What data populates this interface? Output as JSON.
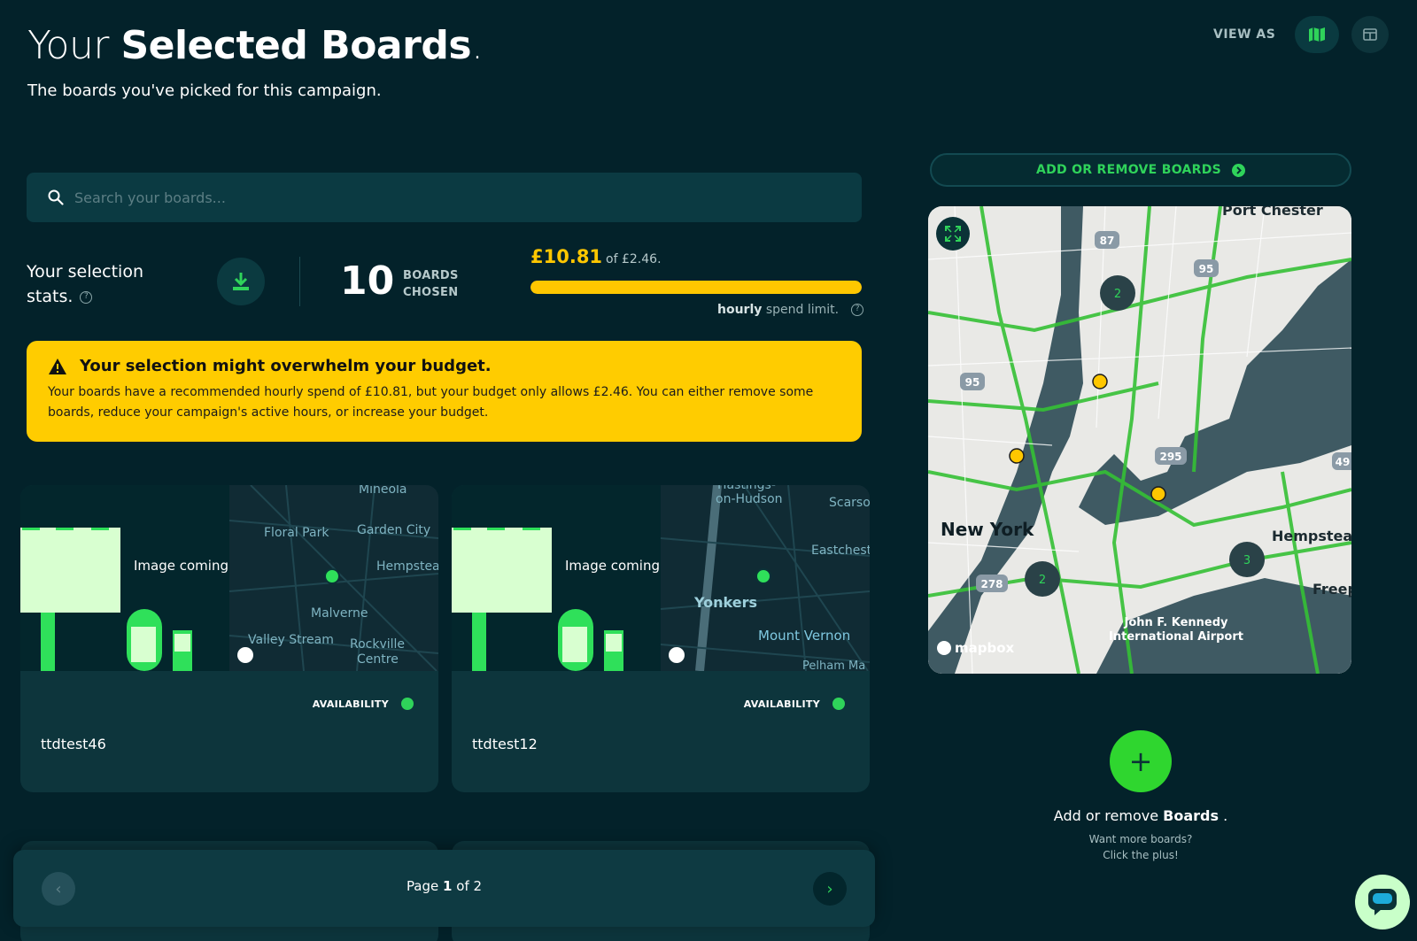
{
  "header": {
    "title_light": "Your",
    "title_bold": "Selected Boards",
    "title_dot": ".",
    "subtitle": "The boards you've picked for this campaign."
  },
  "view_as": {
    "label": "VIEW AS",
    "map_icon": "map-icon",
    "table_icon": "table-icon"
  },
  "search": {
    "placeholder": "Search your boards...",
    "value": ""
  },
  "stats": {
    "label_line1": "Your selection",
    "label_line2": "stats.",
    "help": "?",
    "count": "10",
    "count_label_1": "BOARDS",
    "count_label_2": "CHOSEN",
    "spend_value": "£10.81",
    "spend_of": "of £2.46.",
    "spend_progress_percent": 100,
    "note_bold": "hourly",
    "note_rest": "spend limit.",
    "bar_color": "#ffc700"
  },
  "warning": {
    "title": "Your selection might overwhelm your budget.",
    "text": "Your boards have a recommended hourly spend of £10.81, but your budget only allows £2.46. You can either remove some boards, reduce your campaign's active hours, or increase your budget."
  },
  "boards": [
    {
      "name": "ttdtest46",
      "availability_label": "AVAILABILITY",
      "image_caption": "Image coming s",
      "map_labels": [
        "Mineola",
        "Floral Park",
        "Garden City",
        "Hempstea",
        "Malverne",
        "Valley Stream",
        "Rockville",
        "Centre"
      ]
    },
    {
      "name": "ttdtest12",
      "availability_label": "AVAILABILITY",
      "image_caption": "Image coming s",
      "map_labels": [
        "Hastings-",
        "on-Hudson",
        "Scarso",
        "Eastchest",
        "Yonkers",
        "Mount Vernon",
        "Pelham Ma"
      ]
    }
  ],
  "pager": {
    "prefix": "Page",
    "current": "1",
    "middle": "of",
    "total": "2"
  },
  "side": {
    "add_remove_label": "ADD OR REMOVE BOARDS",
    "map_labels": [
      "Port Chester",
      "New York",
      "Hempstead",
      "Freep",
      "John F. Kennedy",
      "International Airport",
      "mapbox"
    ],
    "clusters": [
      "2",
      "2",
      "3"
    ],
    "highways": [
      "87",
      "95",
      "95",
      "295",
      "278",
      "49"
    ],
    "add_title_prefix": "Add or remove",
    "add_title_bold": "Boards",
    "add_title_suffix": ".",
    "add_sub_1": "Want more boards?",
    "add_sub_2": "Click the plus!",
    "plus": "+"
  },
  "colors": {
    "background": "#03222a",
    "accent_green": "#2fd35a",
    "warning_yellow": "#ffcc00"
  }
}
